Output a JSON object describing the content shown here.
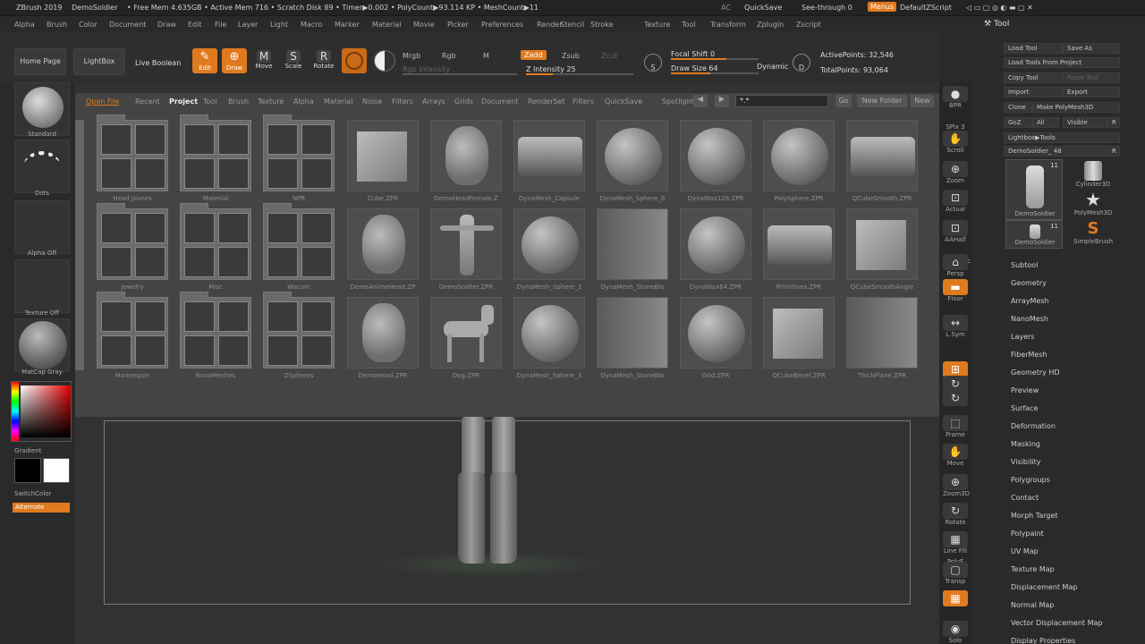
{
  "titlebar": {
    "app": "ZBrush 2019",
    "doc": "DemoSoldier",
    "stats": "• Free Mem 4.635GB • Active Mem 716 • Scratch Disk 89 • Timer▶0.002 • PolyCount▶93.114 KP • MeshCount▶11",
    "ac": "AC",
    "quicksave": "QuickSave",
    "seethrough": "See-through  0",
    "menus": "Menus",
    "script": "DefaultZScript"
  },
  "menubar": [
    "Alpha",
    "Brush",
    "Color",
    "Document",
    "Draw",
    "Edit",
    "File",
    "Layer",
    "Light",
    "Macro",
    "Marker",
    "Material",
    "Movie",
    "Picker",
    "Preferences",
    "Render",
    "Stencil",
    "Stroke",
    "Texture",
    "Tool",
    "Transform",
    "Zplugin",
    "Zscript"
  ],
  "shelf": {
    "home": "Home Page",
    "lightbox": "LightBox",
    "live_boolean": "Live Boolean",
    "edit": "Edit",
    "draw": "Draw",
    "move": "Move",
    "scale": "Scale",
    "rotate": "Rotate",
    "mrgb": "Mrgb",
    "rgb": "Rgb",
    "m": "M",
    "rgb_intensity": "Rgb Intensity",
    "zadd": "Zadd",
    "zsub": "Zsub",
    "zcut": "Zcut",
    "z_intensity": "Z Intensity 25",
    "focal_shift": "Focal Shift 0",
    "draw_size": "Draw Size 64",
    "dynamic": "Dynamic",
    "active_points": "ActivePoints: 32,546",
    "total_points": "TotalPoints: 93,064",
    "icon_s": "S",
    "icon_d": "D",
    "icon_m": "M",
    "icon_s2": "S",
    "icon_r": "R",
    "icon_pen": "✎",
    "icon_cross": "⊕"
  },
  "left": {
    "brush": "Standard",
    "stroke": "Dots",
    "alpha": "Alpha Off",
    "texture": "Texture Off",
    "material": "MatCap Gray",
    "gradient": "Gradient",
    "switchcolor": "SwitchColor",
    "alternate": "Alternate"
  },
  "lightbox": {
    "tabs": [
      "Open File",
      "Recent",
      "Project",
      "Tool",
      "Brush",
      "Texture",
      "Alpha",
      "Material",
      "Noise",
      "Filters",
      "Arrays",
      "Grids",
      "Document",
      "RenderSet",
      "Filters",
      "QuickSave",
      "Spotlight"
    ],
    "search": "*.*",
    "go": "Go",
    "new_folder": "New Folder",
    "new": "New",
    "rows": [
      [
        "Head planes",
        "Material",
        "NPR",
        "Cube.ZPR",
        "DemoHeadFemale.Z",
        "DynaMesh_Capsule",
        "DynaMesh_Sphere_6",
        "DynaWax128.ZPR",
        "PolySphere.ZPR",
        "QCubeSmooth.ZPR"
      ],
      [
        "Jewelry",
        "Misc",
        "Wacom",
        "DemoAnimeHead.ZP",
        "DemoSoldier.ZPR",
        "DynaMesh_Sphere_1",
        "DynaMesh_StoneBlo",
        "DynaWax64.ZPR",
        "Primitives.ZPR",
        "QCubeSmoothAngle"
      ],
      [
        "Mannequin",
        "NanoMeshes",
        "ZSpheres",
        "DemoHead.ZPR",
        "Dog.ZPR",
        "DynaMesh_Sphere_3",
        "DynaMesh_StoneBlo",
        "Grid.ZPR",
        "QCubeBevel.ZPR",
        "ThickPlane.ZPR"
      ]
    ]
  },
  "rightcol": [
    "BPR",
    "SPix 3",
    "Scroll",
    "Zoom",
    "Actual",
    "AAHalf",
    "Dynamic",
    "Persp",
    "Floor",
    "L.Sym",
    "",
    "XYZ",
    "",
    "",
    "Frame",
    "Move",
    "Zoom3D",
    "Rotate",
    "Line Fill",
    "PolyF",
    "Transp",
    "",
    "Solo"
  ],
  "tool": {
    "title": "Tool",
    "load_tool": "Load Tool",
    "save_as": "Save As",
    "load_project": "Load Tools From Project",
    "copy_tool": "Copy Tool",
    "paste_tool": "Paste Tool",
    "import": "Import",
    "export": "Export",
    "clone": "Clone",
    "make_polymesh": "Make PolyMesh3D",
    "goz": "GoZ",
    "all": "All",
    "visible": "Visible",
    "r": "R",
    "lightbox_tools": "Lightbox▶Tools",
    "current": "DemoSoldier_ 48",
    "r2": "R",
    "thumbs": [
      "DemoSoldier",
      "Cylinder3D",
      "PolyMesh3D",
      "DemoSoldier",
      "SimpleBrush"
    ],
    "count1": "11",
    "count2": "11",
    "subpalettes": [
      "Subtool",
      "Geometry",
      "ArrayMesh",
      "NanoMesh",
      "Layers",
      "FiberMesh",
      "Geometry HD",
      "Preview",
      "Surface",
      "Deformation",
      "Masking",
      "Visibility",
      "Polygroups",
      "Contact",
      "Morph Target",
      "Polypaint",
      "UV Map",
      "Texture Map",
      "Displacement Map",
      "Normal Map",
      "Vector Displacement Map",
      "Display Properties"
    ]
  },
  "colors": {
    "accent": "#e07a1f",
    "panel": "#2a2a2a",
    "lightbox": "#464646"
  }
}
